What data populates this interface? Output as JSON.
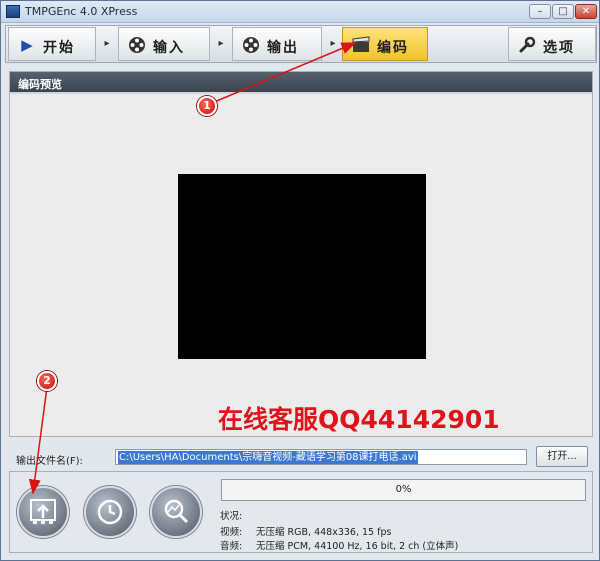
{
  "window": {
    "title": "TMPGEnc 4.0 XPress",
    "minimize": "–",
    "maximize": "□",
    "close": "✕"
  },
  "toolbar": {
    "start": "开始",
    "input": "输入",
    "output": "输出",
    "encode": "编码",
    "options": "选项",
    "arrow": "▸"
  },
  "panel": {
    "header": "编码预览"
  },
  "watermark": "在线客服QQ44142901",
  "output_file": {
    "label": "输出文件名(F):",
    "path": "C:\\Users\\HA\\Documents\\宗嗨音视频-藏语学习第08课打电话.avi",
    "open_button": "打开..."
  },
  "progress": {
    "value": 0,
    "text": "0%"
  },
  "status": {
    "status_label": "状况:",
    "video_label": "视频:",
    "video_value": "无压缩 RGB, 448x336, 15 fps",
    "audio_label": "音频:",
    "audio_value": "无压缩 PCM, 44100 Hz, 16 bit, 2 ch (立体声)"
  },
  "annotations": {
    "badge1": "1",
    "badge2": "2"
  },
  "colors": {
    "active_tab": "#f1c22c",
    "watermark": "#e0121a",
    "annotation": "#d81414",
    "selection": "#3a78d3"
  }
}
